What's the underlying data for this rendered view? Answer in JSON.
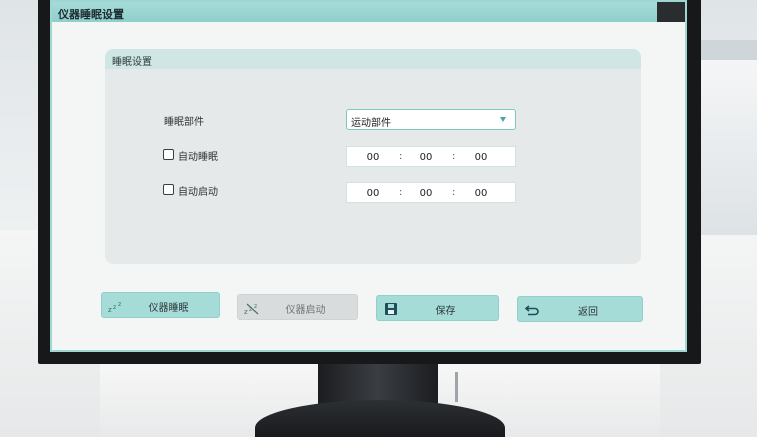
{
  "window": {
    "title": "仪器睡眠设置"
  },
  "panel": {
    "title": "睡眠设置",
    "sleep_part": {
      "label": "睡眠部件",
      "selected": "运动部件"
    },
    "auto_sleep": {
      "label": "自动睡眠",
      "checked": false,
      "hh": "00",
      "mm": "00",
      "ss": "00",
      "sep": ":"
    },
    "auto_start": {
      "label": "自动启动",
      "checked": false,
      "hh": "00",
      "mm": "00",
      "ss": "00",
      "sep": ":"
    }
  },
  "buttons": {
    "sleep": {
      "label": "仪器睡眠",
      "icon": "sleep-zzz-icon"
    },
    "start": {
      "label": "仪器启动",
      "icon": "wake-zzz-icon",
      "disabled": true
    },
    "save": {
      "label": "保存",
      "icon": "floppy-disk-icon"
    },
    "back": {
      "label": "返回",
      "icon": "return-arrow-icon"
    }
  },
  "colors": {
    "accent": "#a5dcd7",
    "title_bar": "#8fcfcb",
    "arrow": "#43a9a0",
    "disabled": "#d8dcdd"
  }
}
